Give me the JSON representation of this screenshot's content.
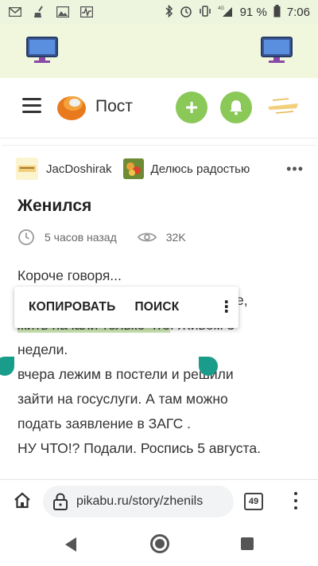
{
  "status_bar": {
    "battery_percent": "91 %",
    "time": "7:06",
    "network": "4G",
    "icons": [
      "gmail-icon",
      "broom-icon",
      "image-icon",
      "activity-icon",
      "bluetooth-icon",
      "alarm-icon",
      "vibrate-icon",
      "signal-icon",
      "battery-icon"
    ]
  },
  "header": {
    "brand": "Пост",
    "add_icon": "+",
    "colors": {
      "accent_green": "#8ac858"
    }
  },
  "post": {
    "author": "JacDoshirak",
    "community": "Делюсь радостью",
    "title": "Женился",
    "time_ago": "5 часов назад",
    "views": "32K",
    "lines": [
      "Короче говоря...",
      "е,",
      "жить начали только что",
      ". Живём 3",
      "недели.",
      "вчера лежим в постели и решили",
      "зайти на госуслуги. А там можно",
      "подать заявление в ЗАГС .",
      "НУ ЧТО!? Подали. Роспись 5 августа."
    ]
  },
  "context_menu": {
    "copy": "КОПИРОВАТЬ",
    "search": "ПОИСК",
    "more": "⋮"
  },
  "browser": {
    "url": "pikabu.ru/story/zhenils",
    "tab_count": "49"
  },
  "selection_color": "#cbe6b4",
  "handle_color": "#1a9c8a"
}
